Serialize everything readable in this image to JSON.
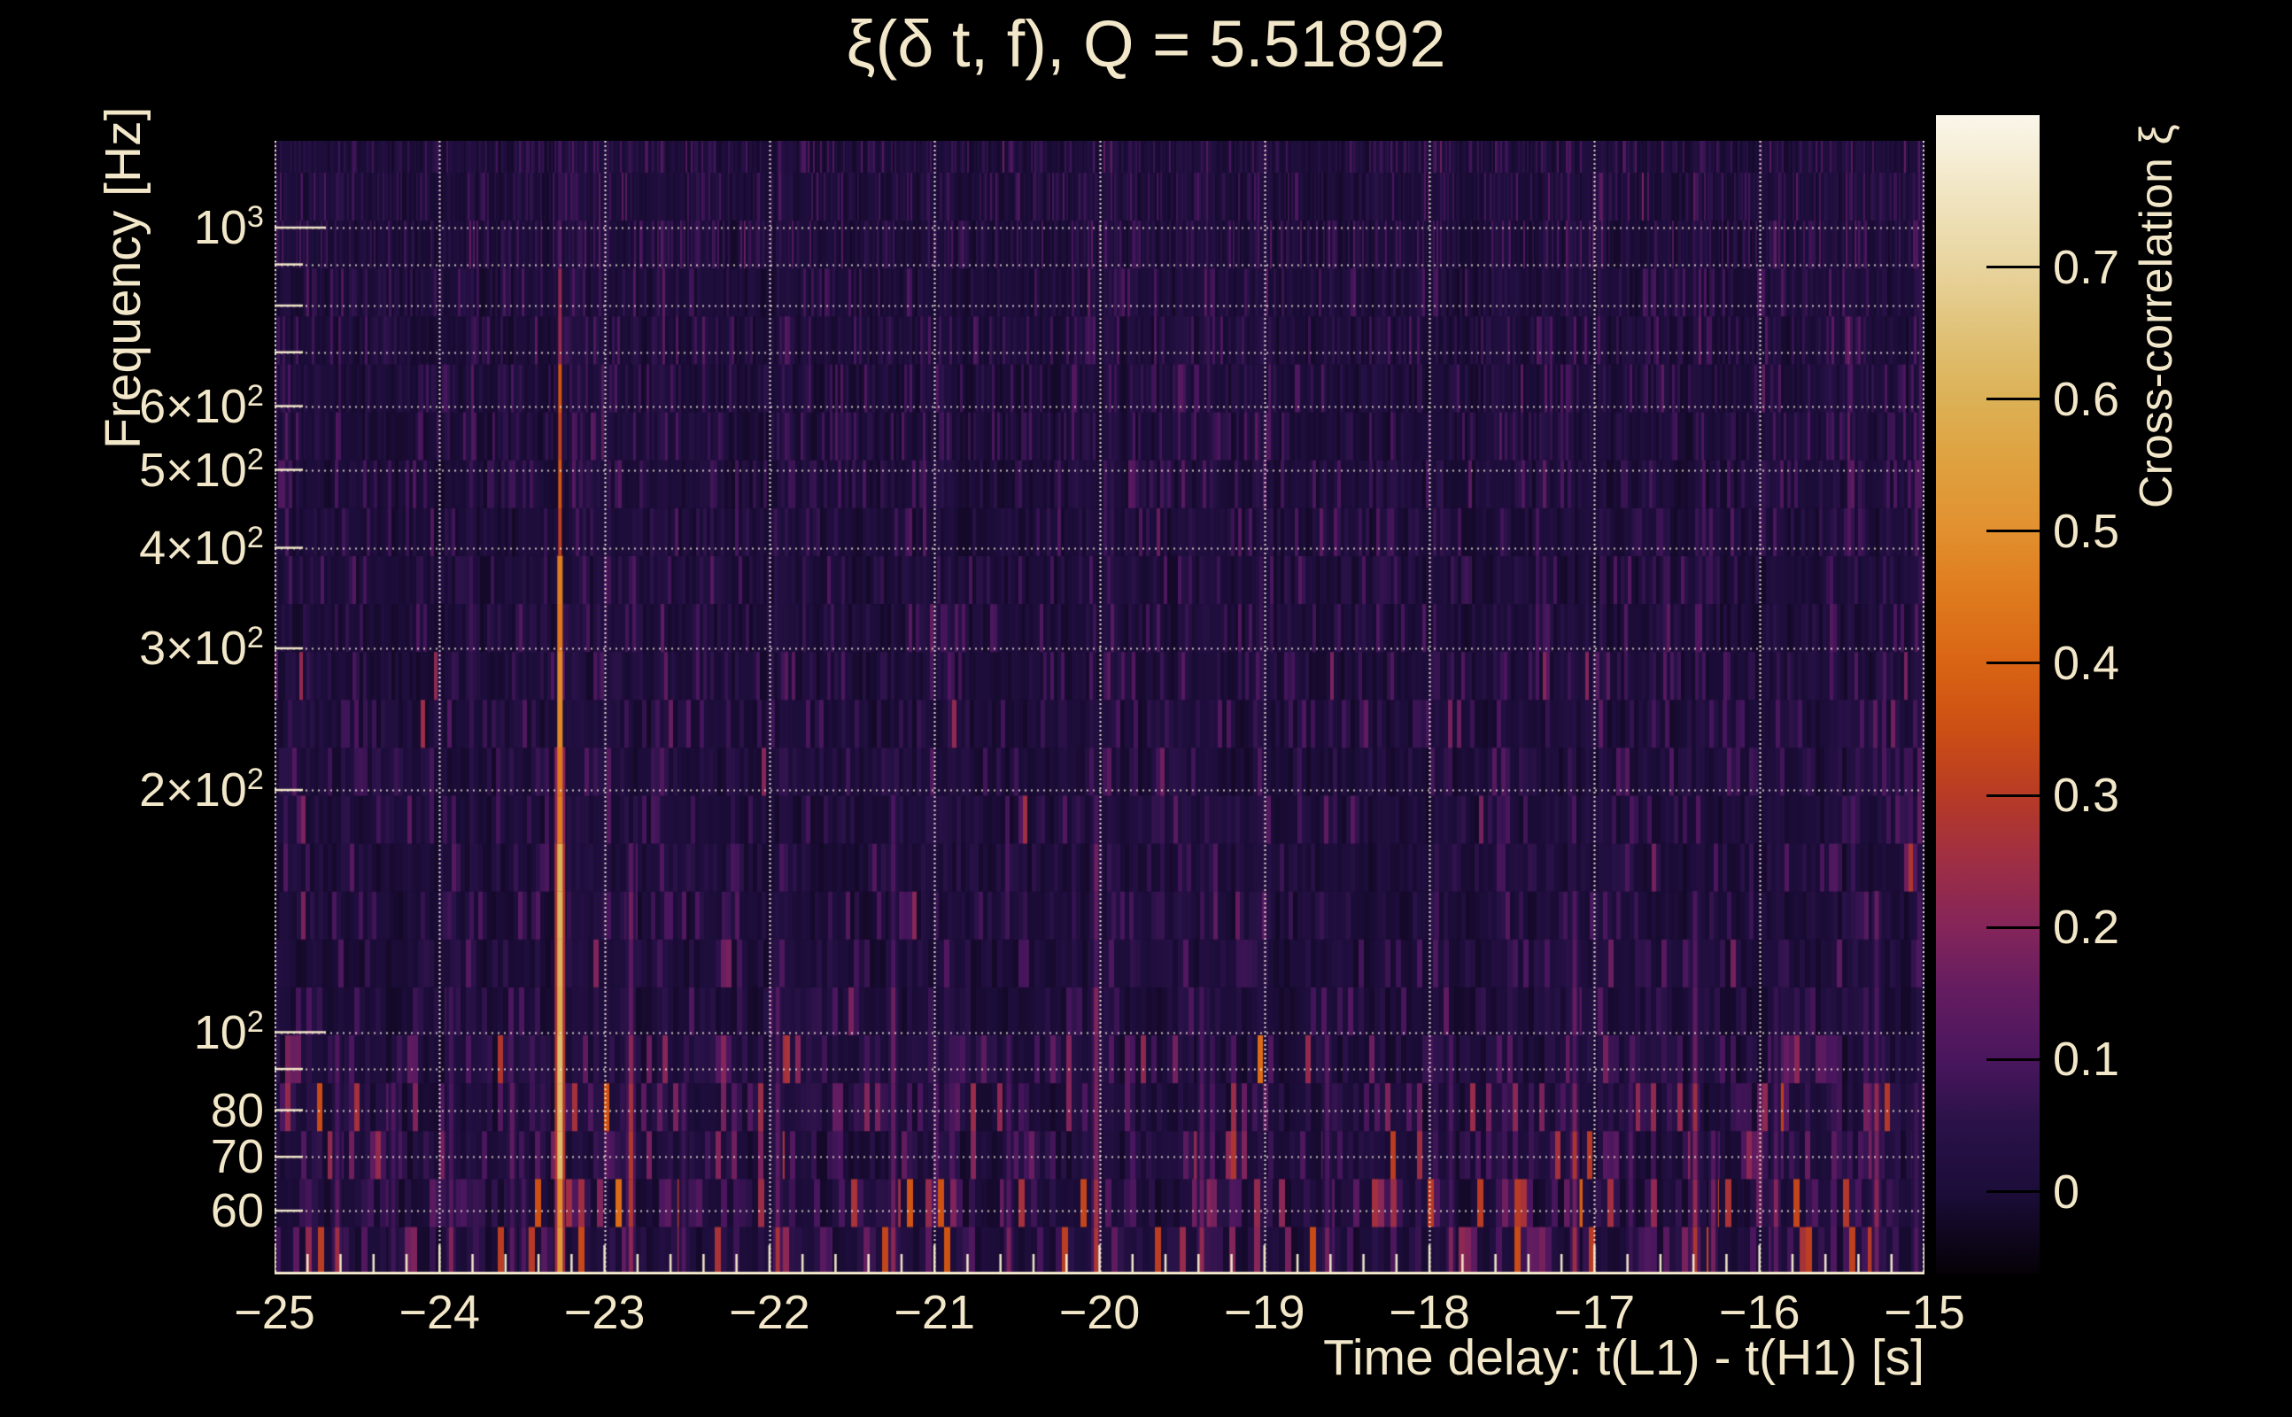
{
  "colors": {
    "background": "#000000",
    "text": "#f2e7c9",
    "grid": "#f5eedc",
    "axis": "#f2e7c9",
    "colorbar_tick": "#000000"
  },
  "chart_data": {
    "type": "heatmap",
    "title": "ξ(δ t, f), Q = 5.51892",
    "q_value": 5.51892,
    "xlabel": "Time delay: t(L1) - t(H1) [s]",
    "ylabel": "Frequency [Hz]",
    "colorbar_label": "Cross-correlation ξ",
    "x_range": [
      -25,
      -15
    ],
    "x_tick_values": [
      -25,
      -24,
      -23,
      -22,
      -21,
      -20,
      -19,
      -18,
      -17,
      -16,
      -15
    ],
    "x_tick_labels": [
      "−25",
      "−24",
      "−23",
      "−22",
      "−21",
      "−20",
      "−19",
      "−18",
      "−17",
      "−16",
      "−15"
    ],
    "x_minor_step": 0.2,
    "y_scale": "log",
    "y_range": [
      50,
      1282
    ],
    "y_ticks": [
      {
        "value": 1000,
        "label": "10^3"
      },
      {
        "value": 600,
        "label": "6×10^2"
      },
      {
        "value": 500,
        "label": "5×10^2"
      },
      {
        "value": 400,
        "label": "4×10^2"
      },
      {
        "value": 300,
        "label": "3×10^2"
      },
      {
        "value": 200,
        "label": "2×10^2"
      },
      {
        "value": 100,
        "label": "10^2"
      },
      {
        "value": 80,
        "label": "80"
      },
      {
        "value": 70,
        "label": "70"
      },
      {
        "value": 60,
        "label": "60"
      }
    ],
    "y_grid_values": [
      60,
      70,
      80,
      90,
      100,
      200,
      300,
      400,
      500,
      600,
      700,
      800,
      900,
      1000
    ],
    "z_range": [
      -0.062,
      0.815
    ],
    "z_tick_values": [
      0,
      0.1,
      0.2,
      0.3,
      0.4,
      0.5,
      0.6,
      0.7
    ],
    "z_tick_labels": [
      "0",
      "0.1",
      "0.2",
      "0.3",
      "0.4",
      "0.5",
      "0.6",
      "0.7"
    ],
    "palette_stops": [
      [
        0.0,
        "#050106"
      ],
      [
        0.071,
        "#1c0d3a"
      ],
      [
        0.13,
        "#2a1248"
      ],
      [
        0.185,
        "#4a165e"
      ],
      [
        0.25,
        "#671d60"
      ],
      [
        0.299,
        "#85255a"
      ],
      [
        0.36,
        "#a02f42"
      ],
      [
        0.413,
        "#b83b25"
      ],
      [
        0.47,
        "#cc4f14"
      ],
      [
        0.527,
        "#d96414"
      ],
      [
        0.59,
        "#df7c1f"
      ],
      [
        0.641,
        "#e2902f"
      ],
      [
        0.7,
        "#dfa13f"
      ],
      [
        0.755,
        "#dcb155"
      ],
      [
        0.81,
        "#e0c176"
      ],
      [
        0.869,
        "#e8d49e"
      ],
      [
        0.94,
        "#f2e7c6"
      ],
      [
        1.0,
        "#faf6ea"
      ]
    ],
    "peak": {
      "dt": -23.27,
      "segments": [
        [
          50,
          70,
          0.5
        ],
        [
          70,
          170,
          0.62
        ],
        [
          170,
          400,
          0.46
        ],
        [
          400,
          700,
          0.34
        ],
        [
          700,
          950,
          0.2
        ],
        [
          950,
          1282,
          0.1
        ]
      ]
    },
    "features": [
      {
        "dt": -24.62,
        "fmax": 100,
        "z": 0.26
      },
      {
        "dt": -24.28,
        "fmax": 92,
        "z": 0.22
      },
      {
        "dt": -23.93,
        "fmax": 120,
        "z": 0.2
      },
      {
        "dt": -23.56,
        "fmax": 85,
        "z": 0.26
      },
      {
        "dt": -23.49,
        "fmax": 70,
        "z": 0.22
      },
      {
        "dt": -22.84,
        "fmax": 180,
        "z": 0.34
      },
      {
        "dt": -22.52,
        "fmax": 90,
        "z": 0.22
      },
      {
        "dt": -21.95,
        "fmax": 110,
        "z": 0.27
      },
      {
        "dt": -21.25,
        "fmax": 200,
        "z": 0.22
      },
      {
        "dt": -20.55,
        "fmax": 100,
        "z": 0.24
      },
      {
        "dt": -20.02,
        "fmax": 200,
        "z": 0.31
      },
      {
        "dt": -19.38,
        "fmax": 120,
        "z": 0.26
      },
      {
        "dt": -18.62,
        "fmax": 100,
        "z": 0.22
      },
      {
        "dt": -17.87,
        "fmax": 105,
        "z": 0.21
      },
      {
        "dt": -17.12,
        "fmax": 160,
        "z": 0.3
      },
      {
        "dt": -16.78,
        "fmax": 90,
        "z": 0.24
      },
      {
        "dt": -16.39,
        "fmax": 160,
        "z": 0.32
      },
      {
        "dt": -16.28,
        "fmax": 80,
        "z": 0.35
      },
      {
        "dt": -15.9,
        "fmax": 120,
        "z": 0.22
      },
      {
        "dt": -15.29,
        "fmax": 150,
        "z": 0.28
      },
      {
        "dt": -15.05,
        "fmax": 90,
        "z": 0.2
      }
    ],
    "noise": {
      "seed": 1337,
      "base_level": 0.015,
      "column_pitch": 9,
      "row_ratio": 1.147
    }
  }
}
